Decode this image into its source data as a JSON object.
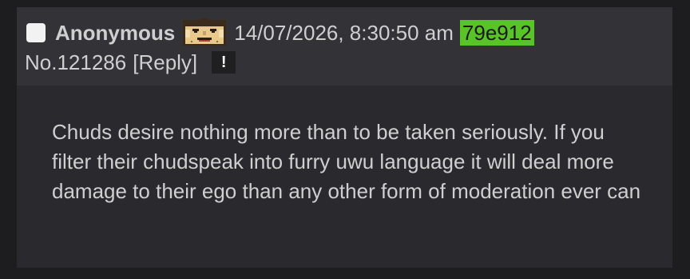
{
  "post": {
    "name": "Anonymous",
    "flag_icon": "pixel-face-flag-icon",
    "timestamp": "14/07/2026, 8:30:50 am",
    "poster_id": "79e912",
    "poster_id_color": "#58c427",
    "post_number": "No.121286",
    "reply_label": "[Reply]",
    "menu_icon": "!",
    "body": "Chuds desire nothing more than to be taken seriously. If you filter their chudspeak into furry uwu language it will deal more damage to their ego than any other form of moderation ever can"
  }
}
